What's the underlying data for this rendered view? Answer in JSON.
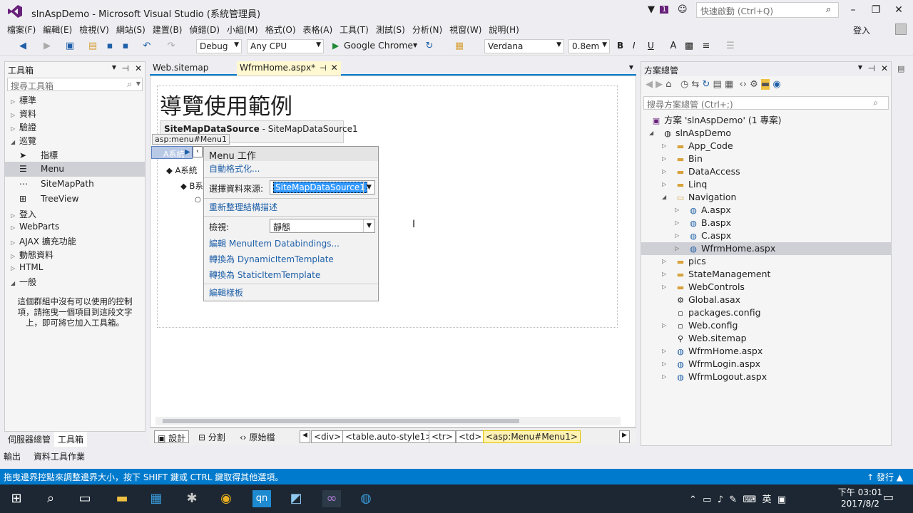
{
  "window": {
    "title": "slnAspDemo - Microsoft Visual Studio (系統管理員)",
    "quick_launch_placeholder": "快速啟動 (Ctrl+Q)",
    "notification_count": "1",
    "sign_in": "登入"
  },
  "menu": [
    "檔案(F)",
    "編輯(E)",
    "檢視(V)",
    "網站(S)",
    "建置(B)",
    "偵錯(D)",
    "小組(M)",
    "格式(O)",
    "表格(A)",
    "工具(T)",
    "測試(S)",
    "分析(N)",
    "視窗(W)",
    "說明(H)"
  ],
  "toolbar": {
    "config": "Debug",
    "platform": "Any CPU",
    "run_target": "Google Chrome",
    "font": "Verdana",
    "size": "0.8em",
    "bold": "B",
    "italic": "I",
    "underline": "U"
  },
  "toolbox": {
    "title": "工具箱",
    "search_placeholder": "搜尋工具箱",
    "groups": [
      "標準",
      "資料",
      "驗證",
      "巡覽"
    ],
    "nav_items": [
      "指標",
      "Menu",
      "SiteMapPath",
      "TreeView"
    ],
    "groups2": [
      "登入",
      "WebParts",
      "AJAX 擴充功能",
      "動態資料",
      "HTML",
      "一般"
    ],
    "note": "這個群組中沒有可以使用的控制項，請拖曳一個項目到這段文字上，即可將它加入工具箱。"
  },
  "bottom_tabs": {
    "server_explorer": "伺服器總管",
    "toolbox": "工具箱",
    "output": "輸出",
    "data_tools": "資料工具作業"
  },
  "doc_tabs": {
    "tab1": "Web.sitemap",
    "tab2": "WfrmHome.aspx*"
  },
  "design": {
    "heading": "導覽使用範例",
    "sds_label": "SiteMapDataSource",
    "sds_name": " - SiteMapDataSource1",
    "menu_tag": "asp:menu#Menu1",
    "menu_root": "A系統",
    "node_a": "A系統",
    "node_b": "B系"
  },
  "smart_tag": {
    "header": "Menu 工作",
    "autoformat": "自動格式化...",
    "choose_ds_label": "選擇資料來源:",
    "choose_ds_value": "SiteMapDataSource1",
    "refresh_schema": "重新整理結構描述",
    "view_label": "檢視:",
    "view_value": "靜態",
    "edit_bindings": "編輯 MenuItem Databindings...",
    "convert_dynamic": "轉換為 DynamicItemTemplate",
    "convert_static": "轉換為 StaticItemTemplate",
    "edit_templates": "編輯樣板"
  },
  "design_bar": {
    "design": "設計",
    "split": "分割",
    "source": "原始檔",
    "crumbs": [
      "<div>",
      "<table.auto-style1>",
      "<tr>",
      "<td>",
      "<asp:Menu#Menu1>"
    ]
  },
  "solution": {
    "title": "方案總管",
    "search_placeholder": "搜尋方案總管 (Ctrl+;)",
    "solution_label": "方案 'slnAspDemo' (1 專案)",
    "project": "slnAspDemo",
    "items": [
      "App_Code",
      "Bin",
      "DataAccess",
      "Linq",
      "Navigation",
      "A.aspx",
      "B.aspx",
      "C.aspx",
      "WfrmHome.aspx",
      "pics",
      "StateManagement",
      "WebControls",
      "Global.asax",
      "packages.config",
      "Web.config",
      "Web.sitemap",
      "WfrmHome.aspx",
      "WfrmLogin.aspx",
      "WfrmLogout.aspx"
    ]
  },
  "status": {
    "message": "拖曳邊界控點來調整邊界大小，按下 SHIFT 鍵或 CTRL 鍵取得其他選項。",
    "publish": "發行"
  },
  "taskbar": {
    "time": "下午 03:01",
    "date": "2017/8/2",
    "ime": "英"
  },
  "colors": {
    "accent": "#007acc",
    "taskbar": "#1c2733",
    "link": "#1e5fa8",
    "selection": "#3399ff"
  }
}
